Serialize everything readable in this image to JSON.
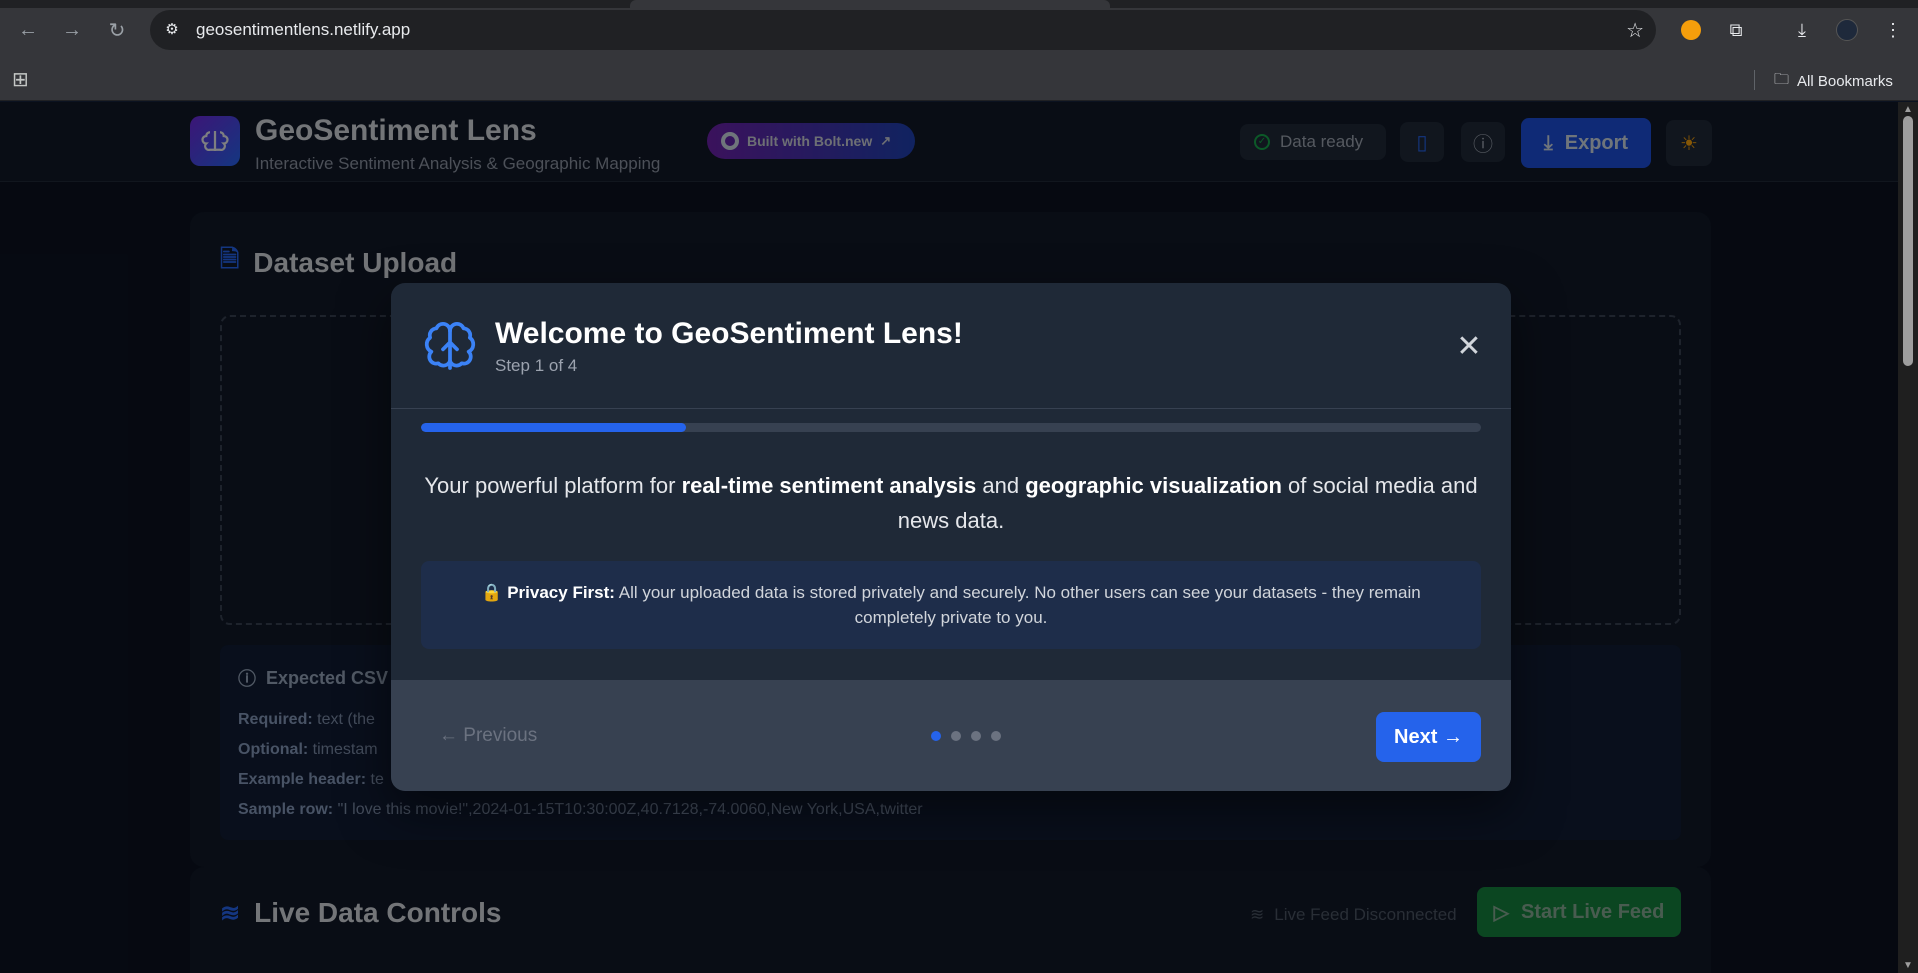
{
  "browser": {
    "url": "geosentimentlens.netlify.app",
    "bookmarks_label": "All Bookmarks"
  },
  "header": {
    "title": "GeoSentiment Lens",
    "subtitle": "Interactive Sentiment Analysis & Geographic Mapping",
    "badge_label": "Built with Bolt.new",
    "status_label": "Data ready",
    "export_label": "Export"
  },
  "upload": {
    "heading": "Dataset Upload",
    "csv_title": "Expected CSV",
    "required_label": "Required:",
    "required_text": "text (the",
    "optional_label": "Optional:",
    "optional_text": "timestam",
    "example_label": "Example header:",
    "example_text": "te",
    "sample_label": "Sample row:",
    "sample_text": "\"I love this movie!\",2024-01-15T10:30:00Z,40.7128,-74.0060,New York,USA,twitter"
  },
  "live": {
    "heading": "Live Data Controls",
    "status": "Live Feed Disconnected",
    "start_label": "Start Live Feed"
  },
  "modal": {
    "title": "Welcome to GeoSentiment Lens!",
    "step": "Step 1 of 4",
    "progress": 0.25,
    "intro_pre": "Your powerful platform for ",
    "intro_bold1": "real-time sentiment analysis",
    "intro_mid": " and ",
    "intro_bold2": "geographic visualization",
    "intro_post": " of social media and news data.",
    "privacy_label": "Privacy First:",
    "privacy_text": " All your uploaded data is stored privately and securely. No other users can see your datasets - they remain completely private to you.",
    "prev_label": "← Previous",
    "next_label": "Next →",
    "total_steps": 4,
    "current_step": 1
  },
  "colors": {
    "accent": "#2563eb",
    "success": "#15803d"
  }
}
